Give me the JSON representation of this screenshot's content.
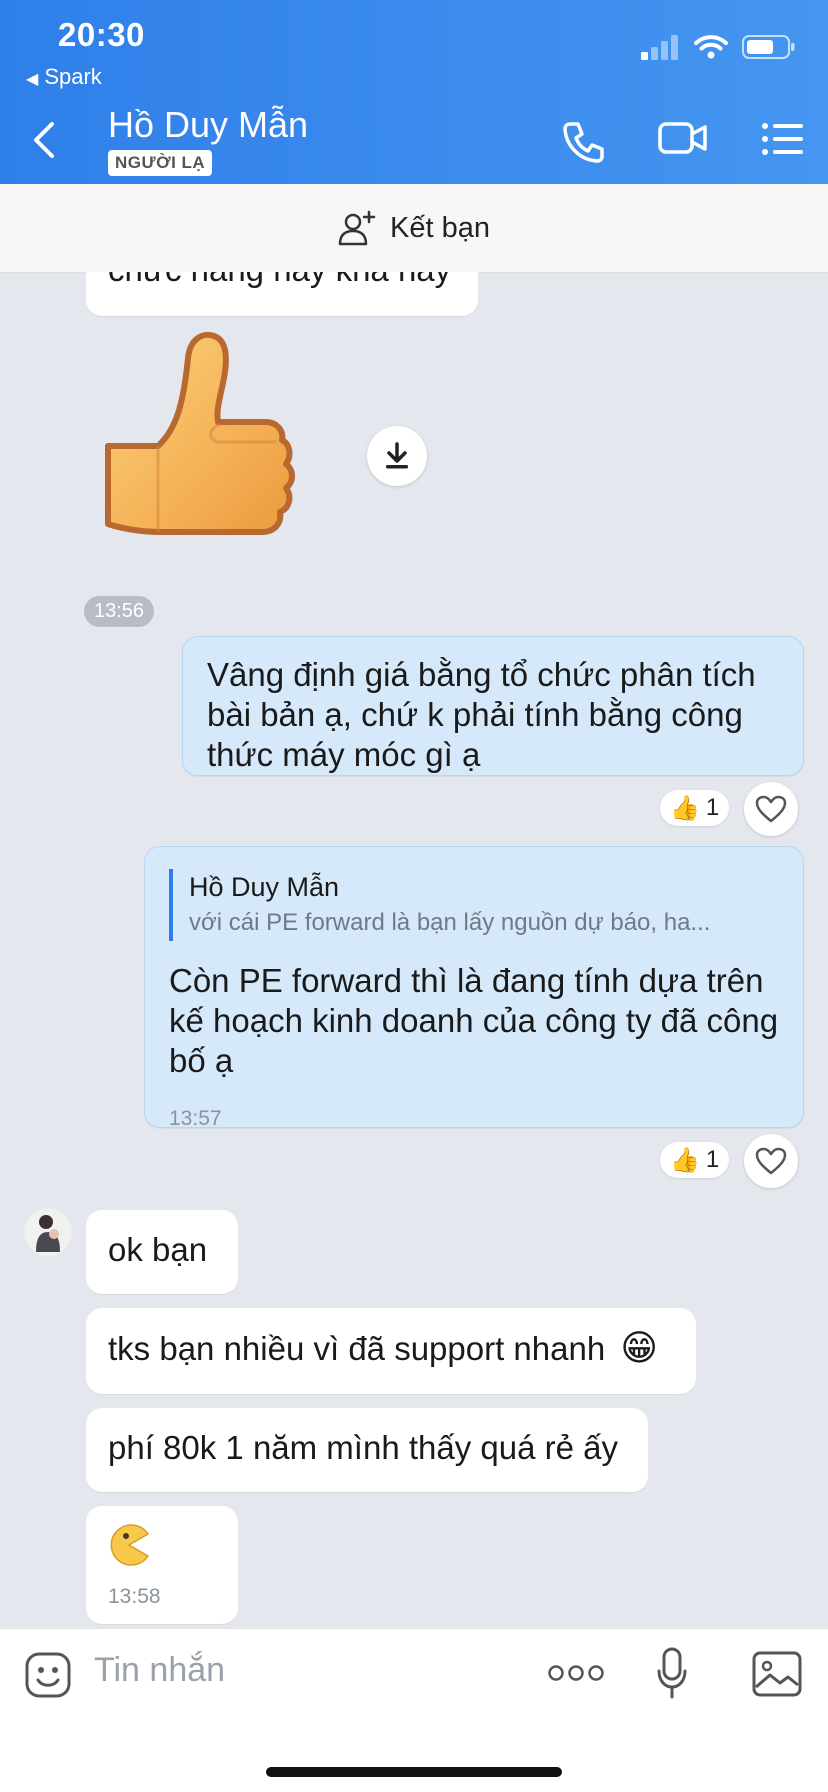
{
  "status": {
    "time": "20:30",
    "back_app": "Spark"
  },
  "header": {
    "contact_name": "Hồ Duy Mẫn",
    "badge": "NGƯỜI LẠ"
  },
  "add_friend": {
    "label": "Kết bạn"
  },
  "messages": {
    "partial": "chức năng này khá hay",
    "sticker_time": "13:56",
    "m1": "Vâng định giá bằng tổ chức phân tích bài bản ạ, chứ k phải tính bằng công thức máy móc gì ạ",
    "m1_reaction_count": "1",
    "m2_quote_name": "Hồ Duy Mẫn",
    "m2_quote_text": "với cái PE forward là bạn lấy nguồn dự báo, ha...",
    "m2": "Còn PE forward thì là đang tính dựa trên kế hoạch kinh doanh của công ty đã công bố ạ",
    "m2_time": "13:57",
    "m2_reaction_count": "1",
    "m3": "ok bạn",
    "m4": "tks bạn nhiều vì đã support nhanh",
    "m5": "phí 80k 1 năm mình thấy quá rẻ ấy",
    "m6_time": "13:58"
  },
  "input": {
    "placeholder": "Tin nhắn"
  },
  "colors": {
    "header_start": "#2f7fea",
    "header_end": "#4596f0",
    "outgoing_bubble": "#d5e9fb",
    "chat_bg": "#e4e7ee"
  }
}
